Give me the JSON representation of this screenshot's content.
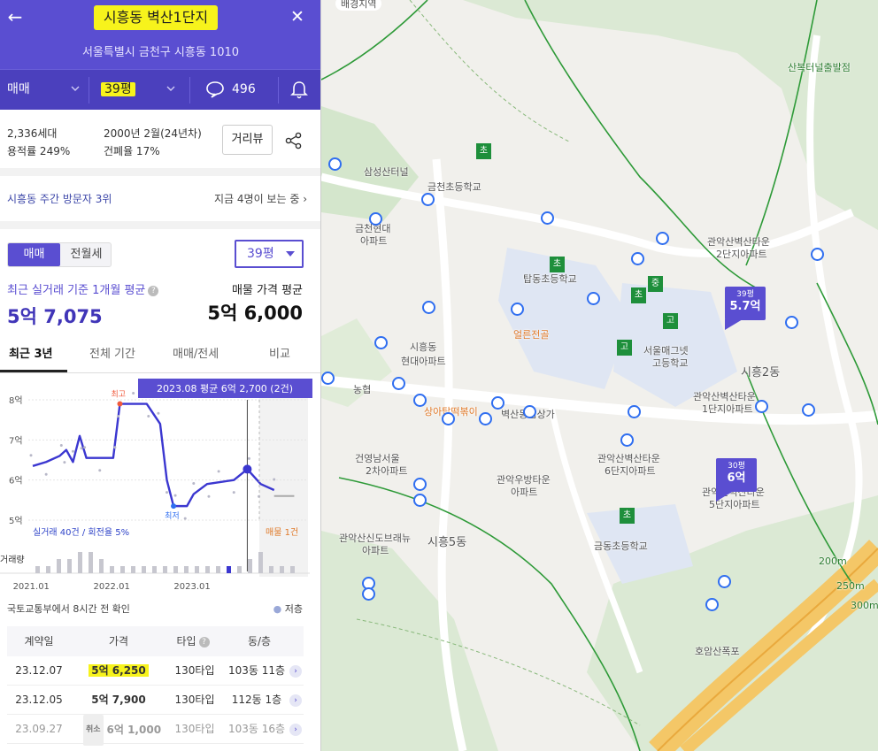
{
  "header": {
    "back_label": "←",
    "close_label": "✕",
    "title": "시흥동 벽산1단지",
    "address": "서울특별시 금천구 시흥동 1010"
  },
  "toolbar": {
    "trade_type": "매매",
    "size": "39평",
    "comment_count": "496"
  },
  "summary": {
    "households": "2,336세대",
    "built": "2000년 2월(24년차)",
    "far": "용적률 249%",
    "bcr": "건폐율 17%",
    "street_view_label": "거리뷰"
  },
  "ranking": {
    "visitor_rank": "시흥동 주간 방문자 3위",
    "now_viewing": "지금 4명이 보는 중"
  },
  "deal_tabs": {
    "sale": "매매",
    "jeonse": "전월세"
  },
  "size_select": "39평",
  "price": {
    "avg_label": "최근 실거래 기준 1개월 평균",
    "avg_value": "5억 7,075",
    "ask_label": "매물 가격 평균",
    "ask_value": "5억 6,000"
  },
  "period_tabs": [
    "최근 3년",
    "전체 기간",
    "매매/전세",
    "비교"
  ],
  "chart_data": {
    "type": "line",
    "y_ticks": [
      "8억",
      "7억",
      "6억",
      "5억"
    ],
    "ylim": [
      5,
      8
    ],
    "x_ticks": [
      "2021.01",
      "2022.01",
      "2023.01"
    ],
    "series": [
      {
        "name": "실거래",
        "x": [
          "2020.12",
          "2021.02",
          "2021.04",
          "2021.05",
          "2021.06",
          "2021.07",
          "2021.08",
          "2021.10",
          "2021.12",
          "2022.01",
          "2022.03",
          "2022.05",
          "2022.07",
          "2022.08",
          "2022.09",
          "2022.11",
          "2022.12",
          "2023.02",
          "2023.04",
          "2023.06",
          "2023.08",
          "2023.10",
          "2023.12"
        ],
        "values": [
          6.35,
          6.45,
          6.6,
          6.75,
          6.45,
          7.1,
          6.55,
          6.55,
          6.55,
          7.9,
          7.9,
          7.9,
          7.4,
          6.0,
          5.35,
          5.35,
          5.65,
          5.9,
          5.95,
          6.0,
          6.27,
          5.9,
          5.75
        ]
      },
      {
        "name": "매물",
        "x": [
          "2023.12",
          "2024.03"
        ],
        "values": [
          5.6,
          5.6
        ]
      }
    ],
    "annotations": {
      "max_label": "최고",
      "min_label": "최저",
      "tooltip": "2023.08 평균 6억 2,700 (2건)",
      "deal_count": "실거래 40건 / 회전율 5%",
      "listing_count": "매물 1건",
      "volume_label": "거래량"
    },
    "volume": [
      1,
      1,
      2,
      2,
      3,
      3,
      2,
      1,
      1,
      1,
      1,
      1,
      1,
      1,
      1,
      1,
      1,
      1,
      1,
      1,
      2,
      3,
      1,
      1,
      1
    ]
  },
  "source_note": "국토교통부에서 8시간 전 확인",
  "low_floor_label": "저층",
  "table": {
    "headers": [
      "계약일",
      "가격",
      "타입",
      "동/층"
    ],
    "rows": [
      {
        "date": "23.12.07",
        "price": "5억 6,250",
        "type": "130타입",
        "floor": "103동 11층",
        "cancelled": false
      },
      {
        "date": "23.12.05",
        "price": "5억 7,900",
        "type": "130타입",
        "floor": "112동 1층",
        "cancelled": false
      },
      {
        "date": "23.09.27",
        "price": "6억 1,000",
        "type": "130타입",
        "floor": "103동 16층",
        "cancelled": true,
        "cancel_label": "취소"
      }
    ]
  },
  "map": {
    "labels": {
      "top_chip": "배경지역",
      "tunnel": "산복터널출발점",
      "samsung": "삼성산터널",
      "geumcheon_school": "금천초등학교",
      "geumcheon_hyundai": "금천현대",
      "geumcheon_hyundai2": "아파트",
      "tapdong": "탑동초등학교",
      "gwanak2": "관악산벽산타운",
      "gwanak2b": "2단지아파트",
      "gwanak1": "관악산벽산타운",
      "gwanak1b": "1단지아파트",
      "seoul_mag": "서울매그넷",
      "seoul_mag2": "고등학교",
      "siheung2": "시흥2동",
      "nonghyup": "농협",
      "sanga": "상아탑떡볶이",
      "sanggga": "벽산동심상가",
      "eolsun": "얼른전골",
      "hyundai": "현대아파트",
      "siheungdong": "시흥동",
      "geonyoung": "건영남서울",
      "geonyoung2": "2차아파트",
      "woobang": "관악우방타운",
      "woobang2": "아파트",
      "gwanak6": "관악산벽산타운",
      "gwanak6b": "6단지아파트",
      "gwanak5": "관악산벽산타운",
      "gwanak5b": "5단지아파트",
      "gwanaksinsin": "관악산신도브래뉴",
      "gwanaksinsin2": "아파트",
      "siheung5": "시흥5동",
      "geumdong": "금동초등학교",
      "hoam": "호암산폭포",
      "dist_200": "200m",
      "dist_250": "250m",
      "dist_300": "300m"
    },
    "pins": [
      {
        "size": "39평",
        "price": "5.7억"
      },
      {
        "size": "30평",
        "price": "6억"
      }
    ],
    "school_marks": [
      "초",
      "초",
      "초",
      "중",
      "고",
      "고",
      "초"
    ]
  }
}
